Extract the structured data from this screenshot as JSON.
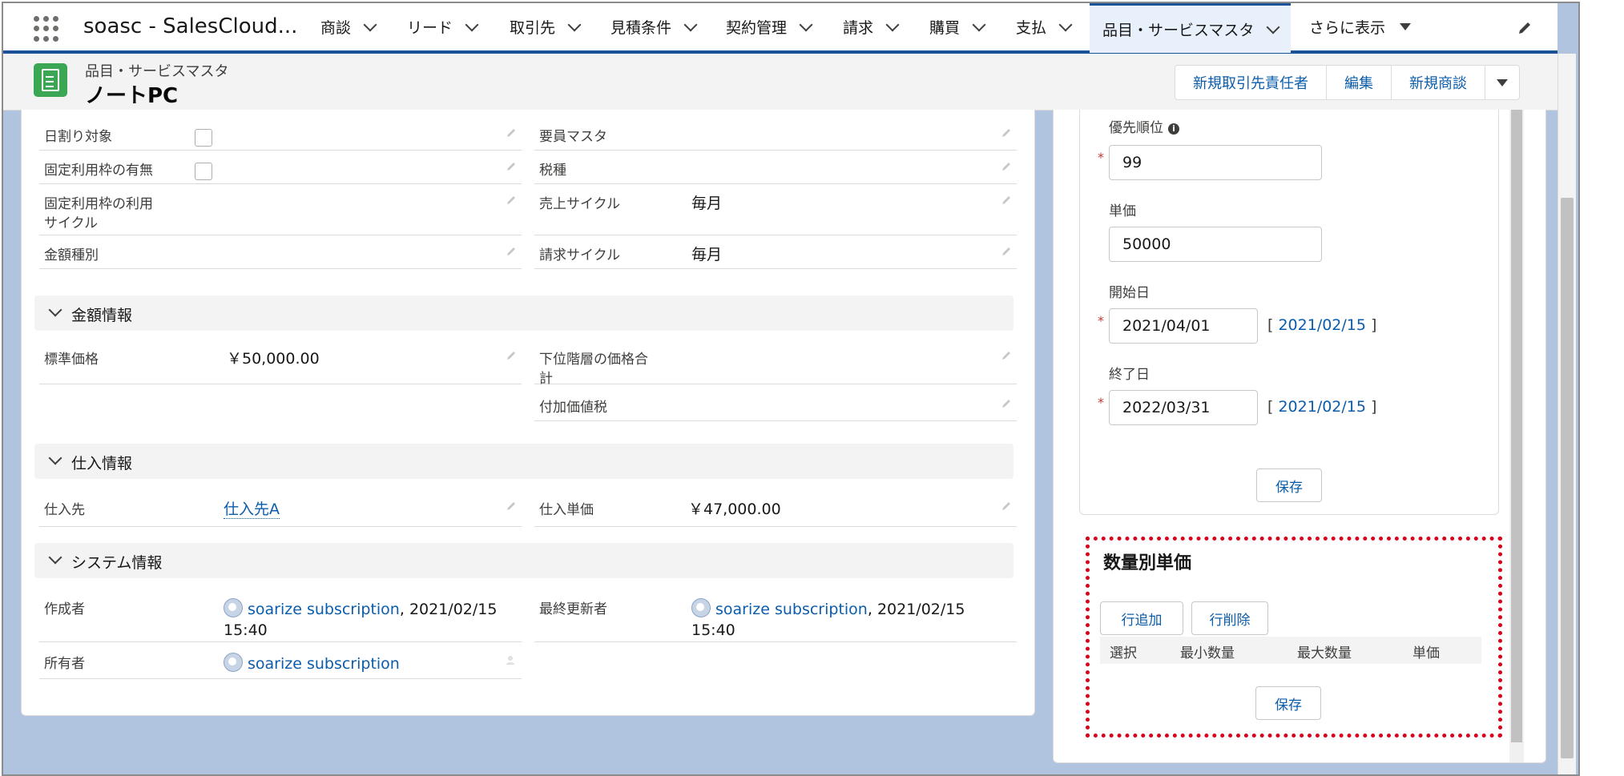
{
  "nav": {
    "app_name": "soasc - SalesCloud...",
    "tabs": [
      "商談",
      "リード",
      "取引先",
      "見積条件",
      "契約管理",
      "請求",
      "購買",
      "支払",
      "品目・サービスマスタ"
    ],
    "more_label": "さらに表示"
  },
  "header": {
    "object_label": "品目・サービスマスタ",
    "record_title": "ノートPC",
    "buttons": [
      "新規取引先責任者",
      "編集",
      "新規商談"
    ]
  },
  "details": {
    "rows": [
      {
        "left_label": "日割り対象",
        "right_label": "要員マスタ",
        "right_value": ""
      },
      {
        "left_label": "固定利用枠の有無",
        "right_label": "税種",
        "right_value": ""
      },
      {
        "left_label_1": "固定利用枠の利用",
        "left_label_2": "サイクル",
        "right_label": "売上サイクル",
        "right_value": "毎月"
      },
      {
        "left_label": "金額種別",
        "right_label": "請求サイクル",
        "right_value": "毎月"
      }
    ]
  },
  "sections": {
    "amount": {
      "title": "金額情報",
      "std_price_label": "標準価格",
      "std_price_value": "￥50,000.00",
      "lower_total_label_1": "下位階層の価格合",
      "lower_total_label_2": "計",
      "vat_label": "付加価値税"
    },
    "purchase": {
      "title": "仕入情報",
      "supplier_label": "仕入先",
      "supplier_value": "仕入先A",
      "unit_cost_label": "仕入単価",
      "unit_cost_value": "￥47,000.00"
    },
    "system": {
      "title": "システム情報",
      "created_by_label": "作成者",
      "created_by_user": "soarize subscription",
      "created_by_date_1": ", 2021/02/15",
      "created_by_date_2": "15:40",
      "modified_by_label": "最終更新者",
      "modified_by_user": "soarize subscription",
      "modified_by_date_1": ", 2021/02/15",
      "modified_by_date_2": "15:40",
      "owner_label": "所有者",
      "owner_user": "soarize subscription"
    }
  },
  "price_form": {
    "priority_label": "優先順位",
    "priority_value": "99",
    "unit_price_label": "単価",
    "unit_price_value": "50000",
    "start_label": "開始日",
    "start_value": "2021/04/01",
    "start_today": "2021/02/15",
    "end_label": "終了日",
    "end_value": "2022/03/31",
    "end_today": "2021/02/15",
    "save_label": "保存",
    "required_mark": "*",
    "bracket_open": "[",
    "bracket_close": "]"
  },
  "qty_price": {
    "title": "数量別単価",
    "add_row": "行追加",
    "delete_row": "行削除",
    "columns": [
      "選択",
      "最小数量",
      "最大数量",
      "単価"
    ],
    "save_label": "保存"
  },
  "colors": {
    "brand": "#1b5297",
    "link": "#0b5cab",
    "highlight": "#d9001b",
    "object_icon": "#3ba755"
  }
}
